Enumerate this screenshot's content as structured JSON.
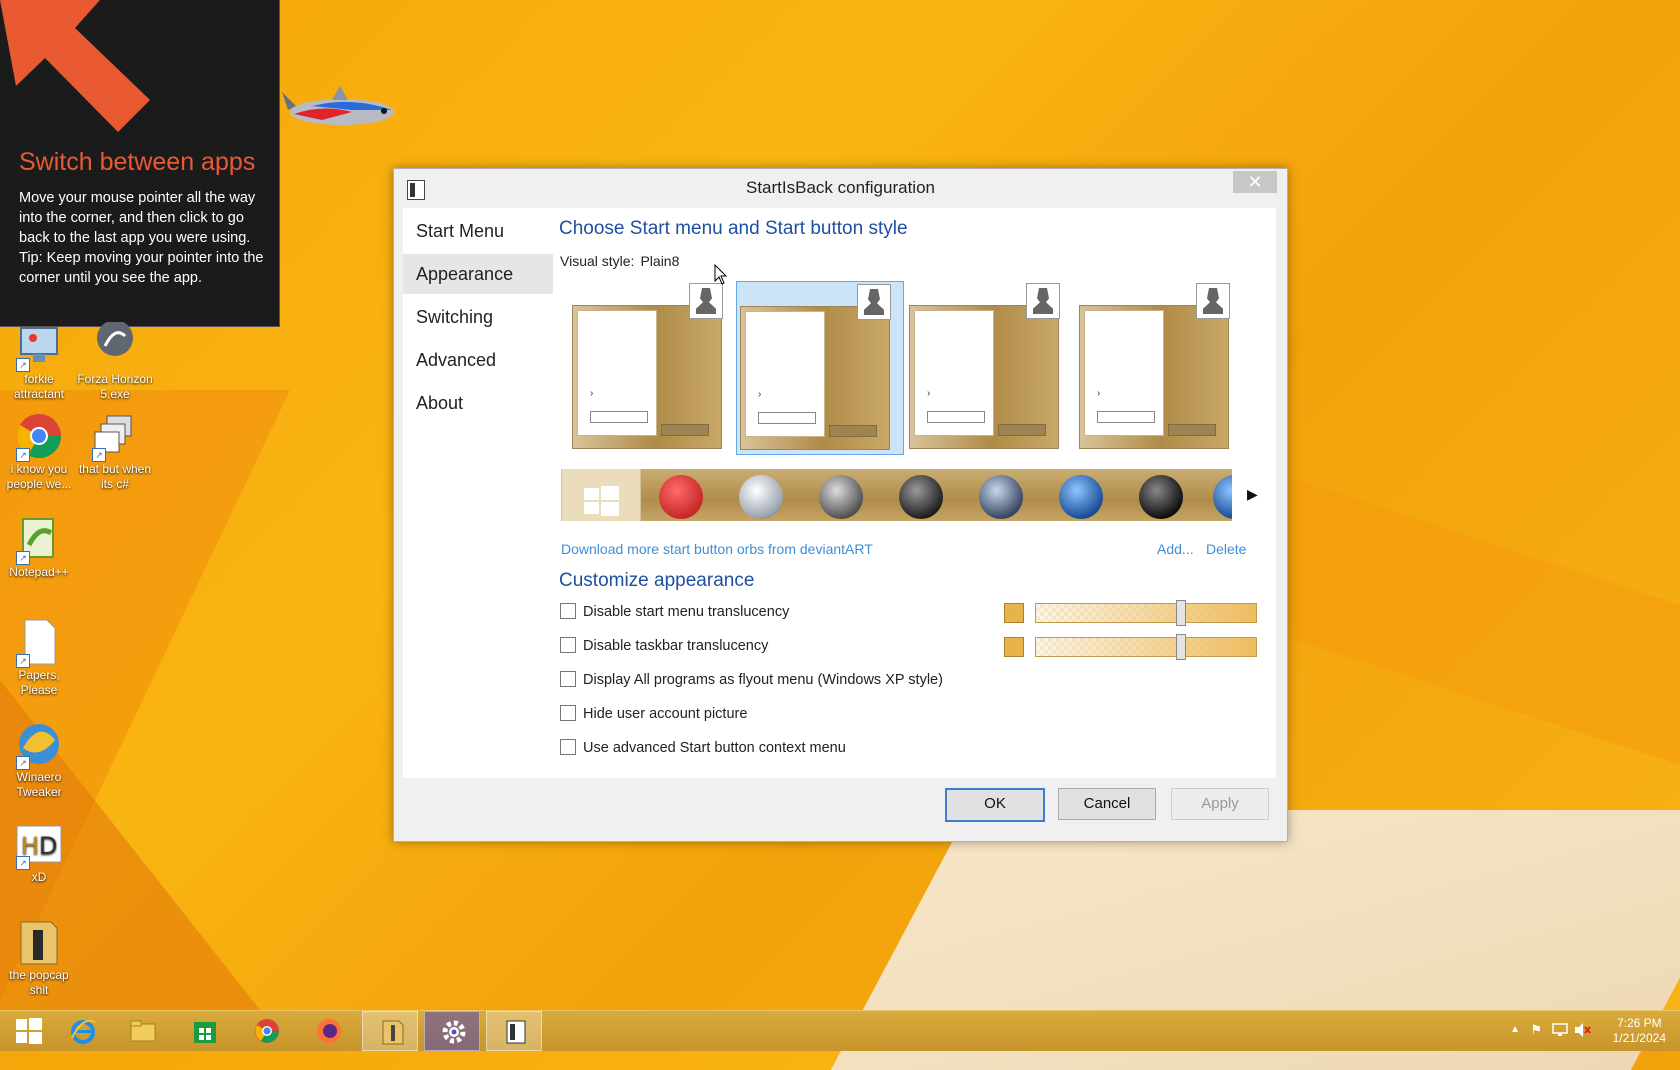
{
  "tip": {
    "title": "Switch between apps",
    "body": "Move your mouse pointer all the way into the corner, and then click to go back to the last app you were using.",
    "hint": "Tip: Keep moving your pointer into the corner until you see the app."
  },
  "desktop_icons": [
    {
      "label": "forkie attractant"
    },
    {
      "label": "Forza Horizon 5.exe"
    },
    {
      "label": "i know you people we..."
    },
    {
      "label": "that but when its c#"
    },
    {
      "label": "Notepad++"
    },
    {
      "label": "Papers, Please"
    },
    {
      "label": "Winaero Tweaker"
    },
    {
      "label": "xD"
    },
    {
      "label": "the popcap shit"
    }
  ],
  "dialog": {
    "title": "StartIsBack configuration",
    "close_glyph": "✕",
    "nav": [
      "Start Menu",
      "Appearance",
      "Switching",
      "Advanced",
      "About"
    ],
    "selected_nav": "Appearance",
    "section1_title": "Choose Start menu and Start button style",
    "visual_style_label": "Visual style:",
    "visual_style_value": "Plain8",
    "download_link": "Download more start button orbs from deviantART",
    "add_link": "Add...",
    "delete_link": "Delete",
    "section2_title": "Customize appearance",
    "options": [
      {
        "label": "Disable start menu translucency",
        "checked": false
      },
      {
        "label": "Disable taskbar translucency",
        "checked": false
      },
      {
        "label": "Display All programs as flyout menu (Windows XP style)",
        "checked": false
      },
      {
        "label": "Hide user account picture",
        "checked": false
      },
      {
        "label": "Use advanced Start button context menu",
        "checked": false
      }
    ],
    "buttons": {
      "ok": "OK",
      "cancel": "Cancel",
      "apply": "Apply"
    }
  },
  "taskbar": {
    "clock_time": "7:26 PM",
    "clock_date": "1/21/2024"
  },
  "colors": {
    "accent": "#1f4fa2",
    "link": "#3c8fd9",
    "tip_title": "#e95a32",
    "taskbar": "#c7952b"
  }
}
